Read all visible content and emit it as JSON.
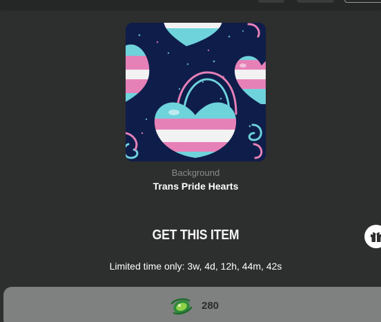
{
  "item": {
    "type_label": "Background",
    "title": "Trans Pride Hearts"
  },
  "purchase": {
    "heading": "GET THIS ITEM",
    "timer_text": "Limited time only: 3w, 4d, 12h, 44m, 42s",
    "price": "280"
  },
  "icons": {
    "gift": "gift-icon",
    "currency": "orb-currency-icon"
  },
  "colors": {
    "background": "#2d2e2e",
    "button": "#7f8180",
    "trans_blue": "#6fd3dc",
    "trans_pink": "#e681b8",
    "trans_white": "#f2f2f2",
    "image_bg": "#0f1d4a"
  }
}
